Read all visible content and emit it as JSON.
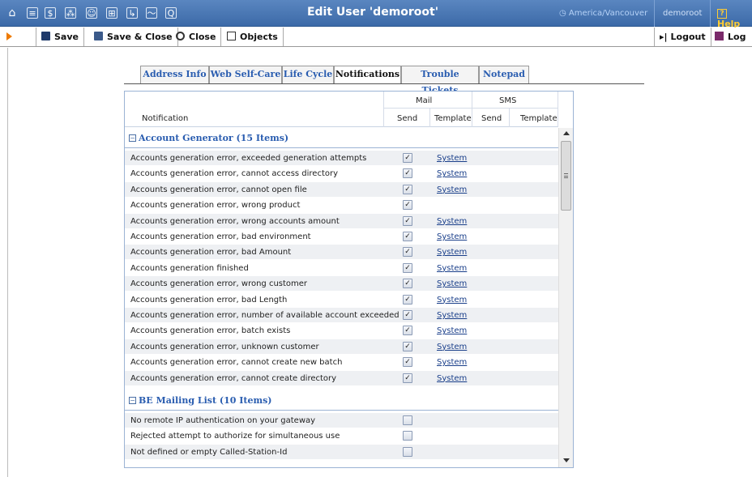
{
  "window": {
    "title": "Edit User 'demoroot'",
    "timezone": "America/Vancouver",
    "user": "demoroot",
    "help": "Help"
  },
  "toolbar": {
    "save": "Save",
    "save_close": "Save & Close",
    "close": "Close",
    "objects": "Objects",
    "logout": "Logout",
    "log": "Log"
  },
  "tabs": [
    "Address Info",
    "Web Self-Care",
    "Life Cycle",
    "Notifications",
    "Trouble Tickets",
    "Notepad"
  ],
  "active_tab": "Notifications",
  "table": {
    "col_notification": "Notification",
    "group_mail": "Mail",
    "group_sms": "SMS",
    "col_send": "Send",
    "col_template": "Template",
    "col_sms_send": "Send",
    "col_sms_template": "Template"
  },
  "groups": [
    {
      "label": "Account Generator (15 Items)",
      "rows": [
        {
          "name": "Accounts generation error, exceeded generation attempts",
          "checked": true,
          "template": "System"
        },
        {
          "name": "Accounts generation error, cannot access directory",
          "checked": true,
          "template": "System"
        },
        {
          "name": "Accounts generation error, cannot open file",
          "checked": true,
          "template": "System"
        },
        {
          "name": "Accounts generation error, wrong product",
          "checked": true,
          "template": ""
        },
        {
          "name": "Accounts generation error, wrong accounts amount",
          "checked": true,
          "template": "System"
        },
        {
          "name": "Accounts generation error, bad environment",
          "checked": true,
          "template": "System"
        },
        {
          "name": "Accounts generation error, bad Amount",
          "checked": true,
          "template": "System"
        },
        {
          "name": "Accounts generation finished",
          "checked": true,
          "template": "System"
        },
        {
          "name": "Accounts generation error, wrong customer",
          "checked": true,
          "template": "System"
        },
        {
          "name": "Accounts generation error, bad Length",
          "checked": true,
          "template": "System"
        },
        {
          "name": "Accounts generation error, number of available account exceeded",
          "checked": true,
          "template": "System"
        },
        {
          "name": "Accounts generation error, batch exists",
          "checked": true,
          "template": "System"
        },
        {
          "name": "Accounts generation error, unknown customer",
          "checked": true,
          "template": "System"
        },
        {
          "name": "Accounts generation error, cannot create new batch",
          "checked": true,
          "template": "System"
        },
        {
          "name": "Accounts generation error, cannot create directory",
          "checked": true,
          "template": "System"
        }
      ]
    },
    {
      "label": "BE Mailing List (10 Items)",
      "rows": [
        {
          "name": "No remote IP authentication on your gateway",
          "checked": false,
          "template": ""
        },
        {
          "name": "Rejected attempt to authorize for simultaneous use",
          "checked": false,
          "template": ""
        },
        {
          "name": "Not defined or empty Called-Station-Id",
          "checked": false,
          "template": ""
        }
      ]
    }
  ]
}
